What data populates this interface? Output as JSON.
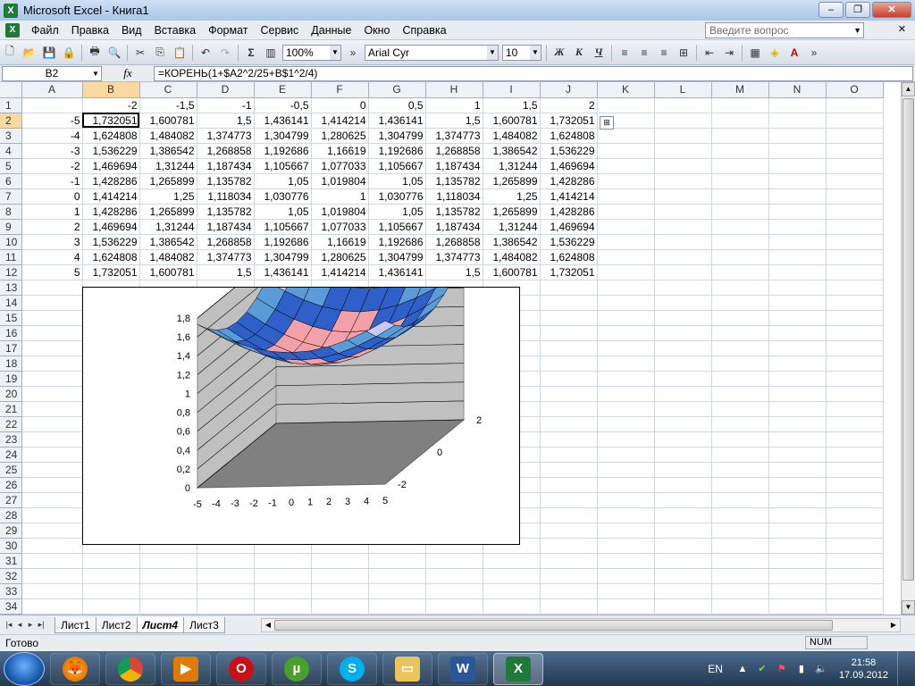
{
  "window": {
    "title": "Microsoft Excel - Книга1",
    "app_icon": "X"
  },
  "window_controls": {
    "minimize": "–",
    "maximize": "❐",
    "close": "✕"
  },
  "menu": {
    "items": [
      "Файл",
      "Правка",
      "Вид",
      "Вставка",
      "Формат",
      "Сервис",
      "Данные",
      "Окно",
      "Справка"
    ],
    "help_placeholder": "Введите вопрос",
    "close_doc": "✕"
  },
  "toolbar": {
    "zoom": "100%",
    "font_name": "Arial Cyr",
    "font_size": "10",
    "sum": "Σ",
    "bold": "Ж",
    "italic": "К",
    "underline": "Ч"
  },
  "formula_bar": {
    "name_box": "B2",
    "fx": "fx",
    "formula": "=КОРЕНЬ(1+$A2^2/25+B$1^2/4)"
  },
  "grid": {
    "columns": [
      "A",
      "B",
      "C",
      "D",
      "E",
      "F",
      "G",
      "H",
      "I",
      "J",
      "K",
      "L",
      "M",
      "N",
      "O"
    ],
    "selected_column": "B",
    "selected_row": "2",
    "rows": [
      {
        "num": "1",
        "cells": [
          "",
          "-2",
          "-1,5",
          "-1",
          "-0,5",
          "0",
          "0,5",
          "1",
          "1,5",
          "2"
        ]
      },
      {
        "num": "2",
        "cells": [
          "-5",
          "1,732051",
          "1,600781",
          "1,5",
          "1,436141",
          "1,414214",
          "1,436141",
          "1,5",
          "1,600781",
          "1,732051"
        ]
      },
      {
        "num": "3",
        "cells": [
          "-4",
          "1,624808",
          "1,484082",
          "1,374773",
          "1,304799",
          "1,280625",
          "1,304799",
          "1,374773",
          "1,484082",
          "1,624808"
        ]
      },
      {
        "num": "4",
        "cells": [
          "-3",
          "1,536229",
          "1,386542",
          "1,268858",
          "1,192686",
          "1,16619",
          "1,192686",
          "1,268858",
          "1,386542",
          "1,536229"
        ]
      },
      {
        "num": "5",
        "cells": [
          "-2",
          "1,469694",
          "1,31244",
          "1,187434",
          "1,105667",
          "1,077033",
          "1,105667",
          "1,187434",
          "1,31244",
          "1,469694"
        ]
      },
      {
        "num": "6",
        "cells": [
          "-1",
          "1,428286",
          "1,265899",
          "1,135782",
          "1,05",
          "1,019804",
          "1,05",
          "1,135782",
          "1,265899",
          "1,428286"
        ]
      },
      {
        "num": "7",
        "cells": [
          "0",
          "1,414214",
          "1,25",
          "1,118034",
          "1,030776",
          "1",
          "1,030776",
          "1,118034",
          "1,25",
          "1,414214"
        ]
      },
      {
        "num": "8",
        "cells": [
          "1",
          "1,428286",
          "1,265899",
          "1,135782",
          "1,05",
          "1,019804",
          "1,05",
          "1,135782",
          "1,265899",
          "1,428286"
        ]
      },
      {
        "num": "9",
        "cells": [
          "2",
          "1,469694",
          "1,31244",
          "1,187434",
          "1,105667",
          "1,077033",
          "1,105667",
          "1,187434",
          "1,31244",
          "1,469694"
        ]
      },
      {
        "num": "10",
        "cells": [
          "3",
          "1,536229",
          "1,386542",
          "1,268858",
          "1,192686",
          "1,16619",
          "1,192686",
          "1,268858",
          "1,386542",
          "1,536229"
        ]
      },
      {
        "num": "11",
        "cells": [
          "4",
          "1,624808",
          "1,484082",
          "1,374773",
          "1,304799",
          "1,280625",
          "1,304799",
          "1,374773",
          "1,484082",
          "1,624808"
        ]
      },
      {
        "num": "12",
        "cells": [
          "5",
          "1,732051",
          "1,600781",
          "1,5",
          "1,436141",
          "1,414214",
          "1,436141",
          "1,5",
          "1,600781",
          "1,732051"
        ]
      }
    ],
    "empty_rows": [
      "13",
      "14",
      "15",
      "16",
      "17",
      "18",
      "19",
      "20",
      "21",
      "22",
      "23",
      "24",
      "25",
      "26",
      "27",
      "28",
      "29",
      "30",
      "31",
      "32",
      "33",
      "34"
    ]
  },
  "chart_data": {
    "type": "surface",
    "x_ticks": [
      "-5",
      "-4",
      "-3",
      "-2",
      "-1",
      "0",
      "1",
      "2",
      "3",
      "4",
      "5"
    ],
    "y_ticks": [
      "-2",
      "0",
      "2"
    ],
    "z_ticks": [
      "0",
      "0,2",
      "0,4",
      "0,6",
      "0,8",
      "1",
      "1,2",
      "1,4",
      "1,6",
      "1,8"
    ],
    "zlim": [
      0,
      1.8
    ],
    "colors": {
      "band_1_1_2": "#f4a0a8",
      "band_1_2_1_4": "#2f5fc8",
      "band_1_4_1_6": "#5b9bd8",
      "band_1_6_1_8": "#c8c8f4",
      "walls": "#c0c0c0",
      "floor": "#808080"
    }
  },
  "sheets": {
    "tabs": [
      "Лист1",
      "Лист2",
      "Лист4",
      "Лист3"
    ],
    "active": "Лист4"
  },
  "status": {
    "ready": "Готово",
    "num": "NUM"
  },
  "taskbar": {
    "lang": "EN",
    "time": "21:58",
    "date": "17.09.2012",
    "apps": [
      "firefox-icon",
      "chrome-icon",
      "media-player-icon",
      "opera-icon",
      "utorrent-icon",
      "skype-icon",
      "explorer-icon",
      "word-icon",
      "excel-icon"
    ]
  }
}
